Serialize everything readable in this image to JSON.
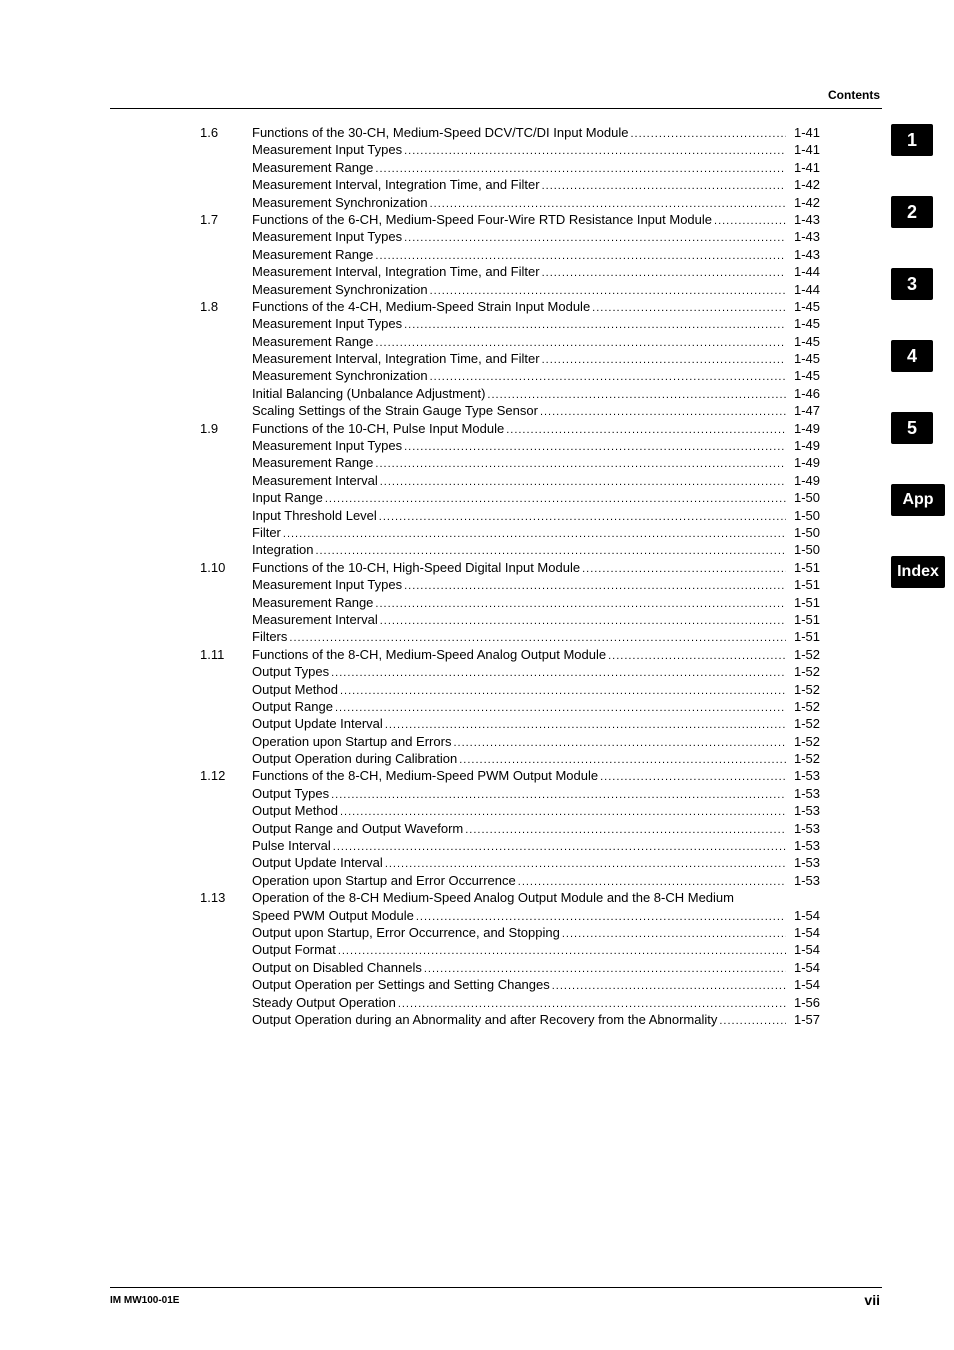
{
  "header": {
    "title": "Contents"
  },
  "footer": {
    "left": "IM MW100-01E",
    "right": "vii"
  },
  "tabs": [
    "1",
    "2",
    "3",
    "4",
    "5",
    "App",
    "Index"
  ],
  "toc": [
    {
      "num": "1.6",
      "title": "Functions of the 30-CH, Medium-Speed DCV/TC/DI Input Module",
      "page": "1-41"
    },
    {
      "title": "Measurement Input Types",
      "page": "1-41"
    },
    {
      "title": "Measurement Range",
      "page": "1-41"
    },
    {
      "title": "Measurement Interval, Integration Time, and Filter",
      "page": "1-42"
    },
    {
      "title": "Measurement Synchronization",
      "page": "1-42"
    },
    {
      "num": "1.7",
      "title": "Functions of the 6-CH, Medium-Speed Four-Wire RTD Resistance Input Module",
      "page": "1-43"
    },
    {
      "title": "Measurement Input Types",
      "page": "1-43"
    },
    {
      "title": "Measurement Range",
      "page": "1-43"
    },
    {
      "title": "Measurement Interval, Integration Time, and Filter",
      "page": "1-44"
    },
    {
      "title": "Measurement Synchronization",
      "page": "1-44"
    },
    {
      "num": "1.8",
      "title": "Functions of the 4-CH, Medium-Speed Strain Input Module",
      "page": "1-45"
    },
    {
      "title": "Measurement Input Types",
      "page": "1-45"
    },
    {
      "title": "Measurement Range",
      "page": "1-45"
    },
    {
      "title": "Measurement Interval, Integration Time, and Filter",
      "page": "1-45"
    },
    {
      "title": "Measurement Synchronization",
      "page": "1-45"
    },
    {
      "title": "Initial Balancing (Unbalance Adjustment)",
      "page": "1-46"
    },
    {
      "title": "Scaling Settings of the Strain Gauge Type Sensor",
      "page": "1-47"
    },
    {
      "num": "1.9",
      "title": "Functions of the 10-CH, Pulse Input Module",
      "page": "1-49"
    },
    {
      "title": "Measurement Input Types",
      "page": "1-49"
    },
    {
      "title": "Measurement Range",
      "page": "1-49"
    },
    {
      "title": "Measurement Interval",
      "page": "1-49"
    },
    {
      "title": "Input Range",
      "page": "1-50"
    },
    {
      "title": "Input Threshold Level",
      "page": "1-50"
    },
    {
      "title": "Filter",
      "page": "1-50"
    },
    {
      "title": "Integration",
      "page": "1-50"
    },
    {
      "num": "1.10",
      "title": "Functions of the 10-CH, High-Speed Digital Input Module",
      "page": "1-51"
    },
    {
      "title": "Measurement Input Types",
      "page": "1-51"
    },
    {
      "title": "Measurement Range",
      "page": "1-51"
    },
    {
      "title": "Measurement Interval",
      "page": "1-51"
    },
    {
      "title": "Filters",
      "page": "1-51"
    },
    {
      "num": "1.11",
      "title": "Functions of the 8-CH, Medium-Speed Analog Output Module",
      "page": "1-52"
    },
    {
      "title": "Output Types",
      "page": "1-52"
    },
    {
      "title": "Output Method",
      "page": "1-52"
    },
    {
      "title": "Output Range",
      "page": "1-52"
    },
    {
      "title": "Output Update Interval",
      "page": "1-52"
    },
    {
      "title": "Operation upon Startup and Errors",
      "page": "1-52"
    },
    {
      "title": "Output Operation during Calibration",
      "page": "1-52"
    },
    {
      "num": "1.12",
      "title": "Functions of the 8-CH, Medium-Speed PWM Output Module",
      "page": "1-53"
    },
    {
      "title": "Output Types",
      "page": "1-53"
    },
    {
      "title": "Output Method",
      "page": "1-53"
    },
    {
      "title": "Output Range and Output Waveform",
      "page": "1-53"
    },
    {
      "title": "Pulse Interval",
      "page": "1-53"
    },
    {
      "title": "Output Update Interval",
      "page": "1-53"
    },
    {
      "title": "Operation upon Startup and Error Occurrence",
      "page": "1-53"
    },
    {
      "num": "1.13",
      "title": "Operation of the 8-CH Medium-Speed Analog Output Module and the 8-CH Medium",
      "page": "",
      "noleader": true
    },
    {
      "title": "Speed PWM Output Module",
      "page": "1-54"
    },
    {
      "title": "Output upon Startup, Error Occurrence, and Stopping",
      "page": "1-54"
    },
    {
      "title": "Output Format",
      "page": "1-54"
    },
    {
      "title": "Output on Disabled Channels",
      "page": "1-54"
    },
    {
      "title": "Output Operation per Settings and Setting Changes",
      "page": "1-54"
    },
    {
      "title": "Steady Output Operation",
      "page": "1-56"
    },
    {
      "title": "Output Operation during an Abnormality and after Recovery from the Abnormality",
      "page": "1-57"
    }
  ]
}
